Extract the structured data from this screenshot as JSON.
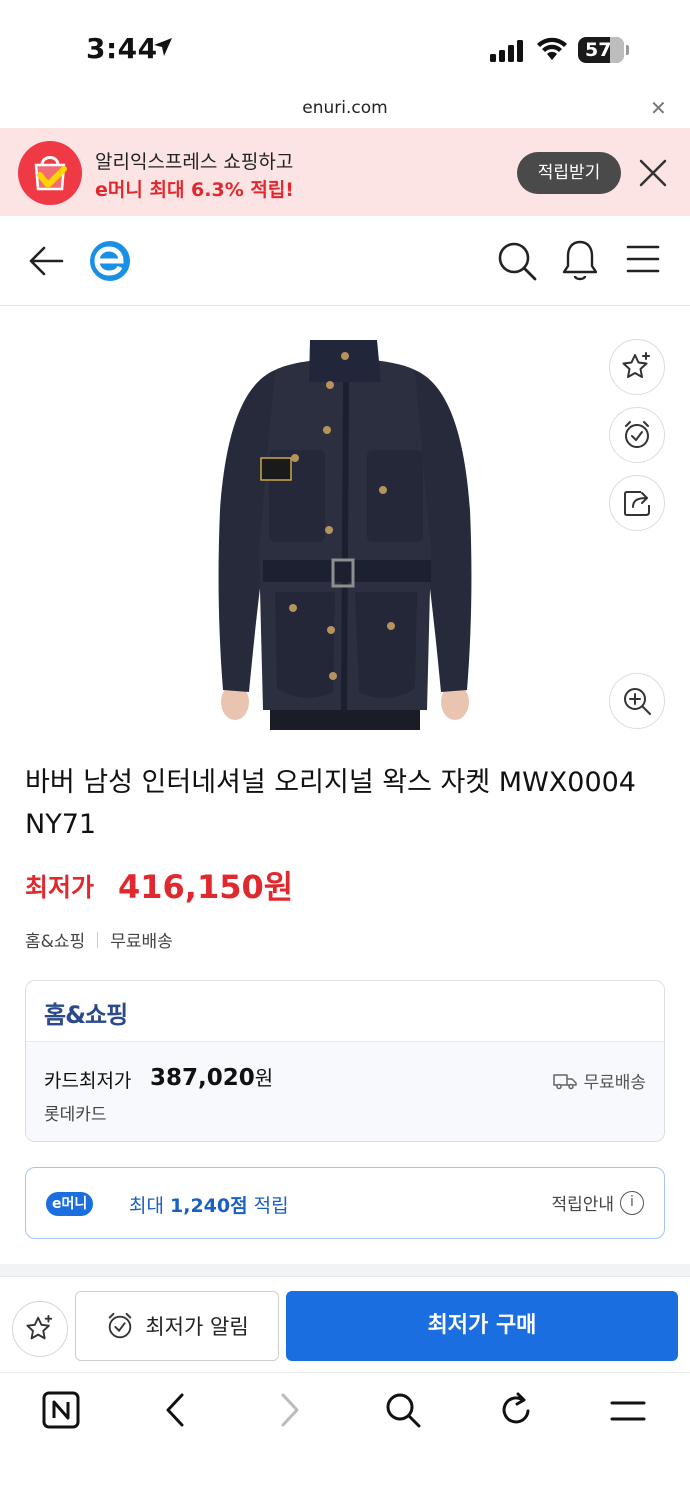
{
  "status_bar": {
    "time": "3:44",
    "battery": "57",
    "icons": [
      "location-arrow-icon",
      "signal-icon",
      "wifi-icon",
      "battery-icon"
    ]
  },
  "browser": {
    "url": "enuri.com"
  },
  "promo": {
    "line1": "알리익스프레스 쇼핑하고",
    "line2": "e머니 최대 6.3% 적립!",
    "button": "적립받기"
  },
  "product": {
    "title": "바버 남성 인터네셔널 오리지널 왁스 자켓 MWX0004 NY71",
    "price_label": "최저가",
    "price": "416,150원",
    "tags": [
      "홈&쇼핑",
      "무료배송"
    ]
  },
  "seller": {
    "name": "홈&쇼핑",
    "card_price_label": "카드최저가",
    "card_price": "387,020",
    "card_price_unit": "원",
    "card_name": "롯데카드",
    "shipping": "무료배송"
  },
  "emoney": {
    "badge": "e머니",
    "prefix": "최대",
    "amount": "1,240점",
    "suffix": "적립",
    "guide": "적립안내"
  },
  "actions": {
    "alert_label": "최저가 알림",
    "buy_label": "최저가 구매"
  },
  "colors": {
    "accent_blue": "#1a6ee0",
    "price_red": "#e0282f",
    "promo_bg": "#fde4e4"
  }
}
